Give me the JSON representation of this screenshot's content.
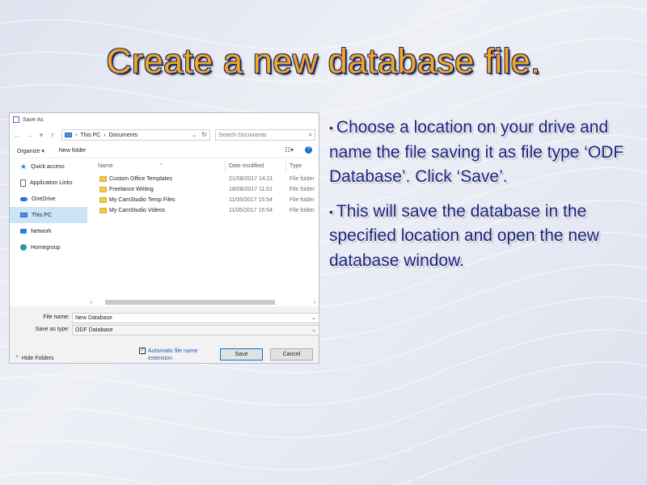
{
  "slide": {
    "title": "Create a new database file.",
    "bullets": [
      "Choose a location on your drive and name the file saving it as file type ‘ODF Database’. Click ‘Save’.",
      "This will save the database in the specified location and open the new database window."
    ],
    "bullet_color": "#1a237e",
    "title_color": "#f5a623"
  },
  "dialog": {
    "title": "Save As",
    "address": {
      "root": "This PC",
      "folder": "Documents",
      "sep": "›"
    },
    "search_placeholder": "Search Documents",
    "toolbar": {
      "organize": "Organize ▾",
      "new_folder": "New folder",
      "help": "?"
    },
    "nav_items": [
      {
        "label": "Quick access",
        "icon": "star-icon"
      },
      {
        "label": "Application Links",
        "icon": "document-icon"
      },
      {
        "label": "OneDrive",
        "icon": "cloud-icon"
      },
      {
        "label": "This PC",
        "icon": "computer-icon"
      },
      {
        "label": "Network",
        "icon": "network-icon"
      },
      {
        "label": "Homegroup",
        "icon": "homegroup-icon"
      }
    ],
    "columns": {
      "name": "Name",
      "date": "Date modified",
      "type": "Type"
    },
    "files": [
      {
        "name": "Custom Office Templates",
        "date": "21/08/2017 14:21",
        "type": "File folder"
      },
      {
        "name": "Freelance Writing",
        "date": "18/08/2017 11:01",
        "type": "File folder"
      },
      {
        "name": "My CamStudio Temp Files",
        "date": "11/05/2017 15:54",
        "type": "File folder"
      },
      {
        "name": "My CamStudio Videos",
        "date": "11/05/2017 15:54",
        "type": "File folder"
      }
    ],
    "file_name_label": "File name:",
    "file_name_value": "New Database",
    "save_as_type_label": "Save as type:",
    "save_as_type_value": "ODF Database",
    "hide_folders": "Hide Folders",
    "auto_extension": "Automatic file name extension",
    "auto_extension_checked": true,
    "save_button": "Save",
    "cancel_button": "Cancel"
  }
}
